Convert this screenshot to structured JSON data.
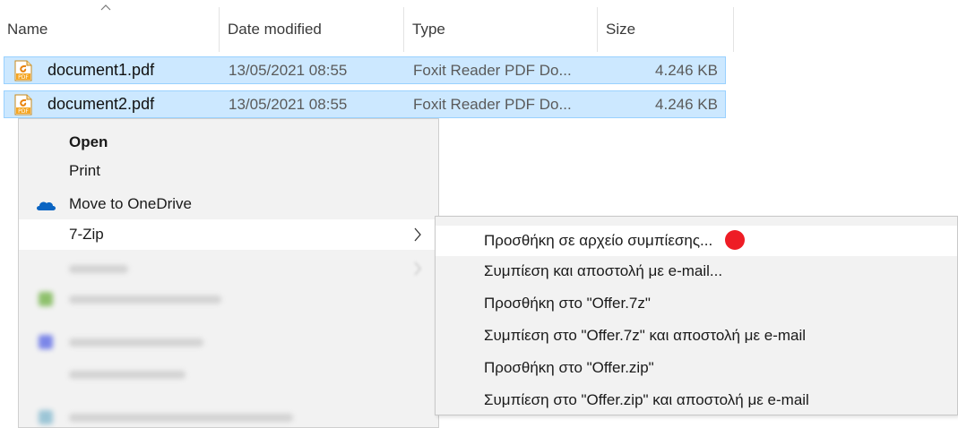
{
  "columns": {
    "name": "Name",
    "date_modified": "Date modified",
    "type": "Type",
    "size": "Size"
  },
  "files": [
    {
      "name": "document1.pdf",
      "date_modified": "13/05/2021 08:55",
      "type": "Foxit Reader PDF Do...",
      "size": "4.246 KB",
      "icon": "pdf-file-icon"
    },
    {
      "name": "document2.pdf",
      "date_modified": "13/05/2021 08:55",
      "type": "Foxit Reader PDF Do...",
      "size": "4.246 KB",
      "icon": "pdf-file-icon"
    }
  ],
  "context_menu": {
    "open": "Open",
    "print": "Print",
    "move_to_onedrive": "Move to OneDrive",
    "seven_zip": "7-Zip"
  },
  "submenu": {
    "items": [
      "Προσθήκη σε αρχείο συμπίεσης...",
      "Συμπίεση και αποστολή με e-mail...",
      "Προσθήκη στο \"Offer.7z\"",
      "Συμπίεση στο \"Offer.7z\" και αποστολή με e-mail",
      "Προσθήκη στο \"Offer.zip\"",
      "Συμπίεση στο \"Offer.zip\" και αποστολή με e-mail"
    ]
  },
  "colors": {
    "selection": "#cce8ff",
    "selection_border": "#99d1ff",
    "menu_bg": "#f2f2f2",
    "pdf_icon": "#f5a623",
    "onedrive": "#0a64c2",
    "annotation_dot": "#ee1c25"
  }
}
